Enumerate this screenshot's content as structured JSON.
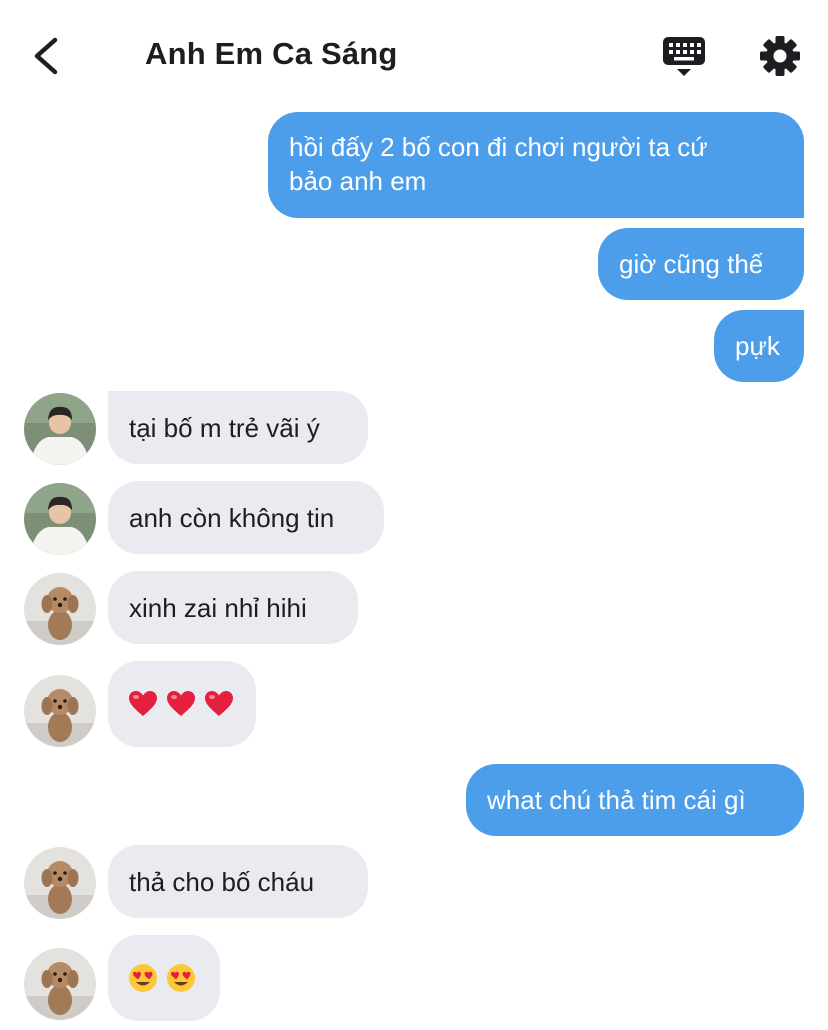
{
  "header": {
    "title": "Anh Em Ca Sáng",
    "back_icon": "chevron-left-icon",
    "keyboard_icon": "keyboard-icon",
    "settings_icon": "gear-icon"
  },
  "colors": {
    "outgoing_bubble": "#4c9eea",
    "incoming_bubble": "#e9ebf0",
    "text_dark": "#1c1e21"
  },
  "messages": [
    {
      "direction": "out",
      "lines": [
        "hồi đấy 2 bố con đi chơi người ta cứ",
        "bảo anh em"
      ]
    },
    {
      "direction": "out",
      "text": "giờ cũng thế"
    },
    {
      "direction": "out",
      "text": "pựk"
    },
    {
      "direction": "in",
      "avatar": "avatar-person",
      "text": "tại bố m trẻ vãi ý"
    },
    {
      "direction": "in",
      "avatar": "avatar-person",
      "text": "anh còn không tin"
    },
    {
      "direction": "in",
      "avatar": "avatar-dog",
      "text": "xinh zai nhỉ hihi"
    },
    {
      "direction": "in",
      "avatar": "avatar-dog",
      "emoji": [
        "red-heart-icon",
        "red-heart-icon",
        "red-heart-icon"
      ]
    },
    {
      "direction": "out",
      "text": "what chú thả tim cái gì"
    },
    {
      "direction": "in",
      "avatar": "avatar-dog",
      "text": "thả cho bố cháu"
    },
    {
      "direction": "in",
      "avatar": "avatar-dog",
      "emoji": [
        "heart-eyes-face-icon",
        "heart-eyes-face-icon"
      ]
    }
  ]
}
